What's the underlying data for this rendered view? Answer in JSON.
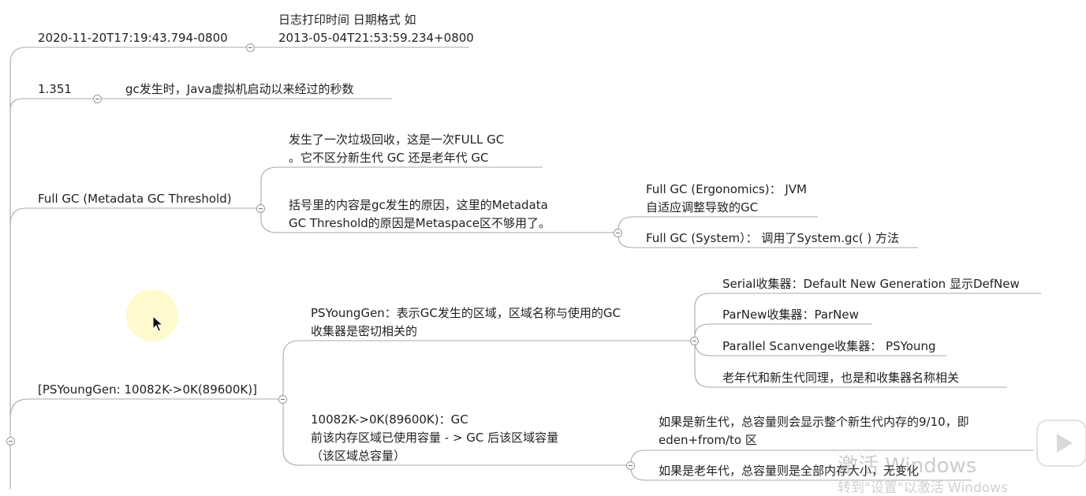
{
  "nodes": {
    "timestamp": "2020-11-20T17:19:43.794-0800",
    "timestamp_desc_1": "日志打印时间 日期格式  如",
    "timestamp_desc_2": "2013-05-04T21:53:59.234+0800",
    "uptime": "1.351",
    "uptime_desc": "gc发生时，Java虚拟机启动以来经过的秒数",
    "fullgc": "Full GC (Metadata GC Threshold)",
    "fullgc_desc1_1": "发生了一次垃圾回收，这是一次FULL GC",
    "fullgc_desc1_2": "。它不区分新生代 GC 还是老年代 GC",
    "fullgc_desc2_1": "括号里的内容是gc发生的原因，这里的Metadata",
    "fullgc_desc2_2": "GC Threshold的原因是Metaspace区不够用了。",
    "ergonomics_1": "Full GC (Ergonomics)： JVM",
    "ergonomics_2": "自适应调整导致的GC",
    "system_gc": "Full GC (System）：  调用了System.gc( ) 方法",
    "psyounggen": "[PSYoungGen: 10082K->0K(89600K)]",
    "psyoung_desc_1": "PSYoungGen：表示GC发生的区域，区域名称与使用的GC",
    "psyoung_desc_2": "收集器是密切相关的",
    "serial": "Serial收集器：Default New Generation  显示DefNew",
    "parnew": "ParNew收集器：ParNew",
    "parallel": "Parallel Scanvenge收集器：  PSYoung",
    "old_gen": "老年代和新生代同理，也是和收集器名称相关",
    "capacity_1": "10082K->0K(89600K)：GC",
    "capacity_2": "前该内存区域已使用容量 - > GC 后该区域容量",
    "capacity_3": "（该区域总容量）",
    "new_gen_total_1": "如果是新生代，总容量则会显示整个新生代内存的9/10，即",
    "new_gen_total_2": "eden+from/to 区",
    "old_gen_total": "如果是老年代，总容量则是全部内存大小，无变化"
  },
  "overlay": {
    "watermark": "激活 Windows",
    "watermark_sub": "转到\"设置\"以激活 Windows"
  },
  "colors": {
    "connector": "#a9a9a9",
    "text": "#222222",
    "highlight": "#fff8be"
  },
  "icons": {
    "collapse": "minus-circle-icon",
    "cursor": "arrow-cursor-icon",
    "player": "play-icon"
  }
}
